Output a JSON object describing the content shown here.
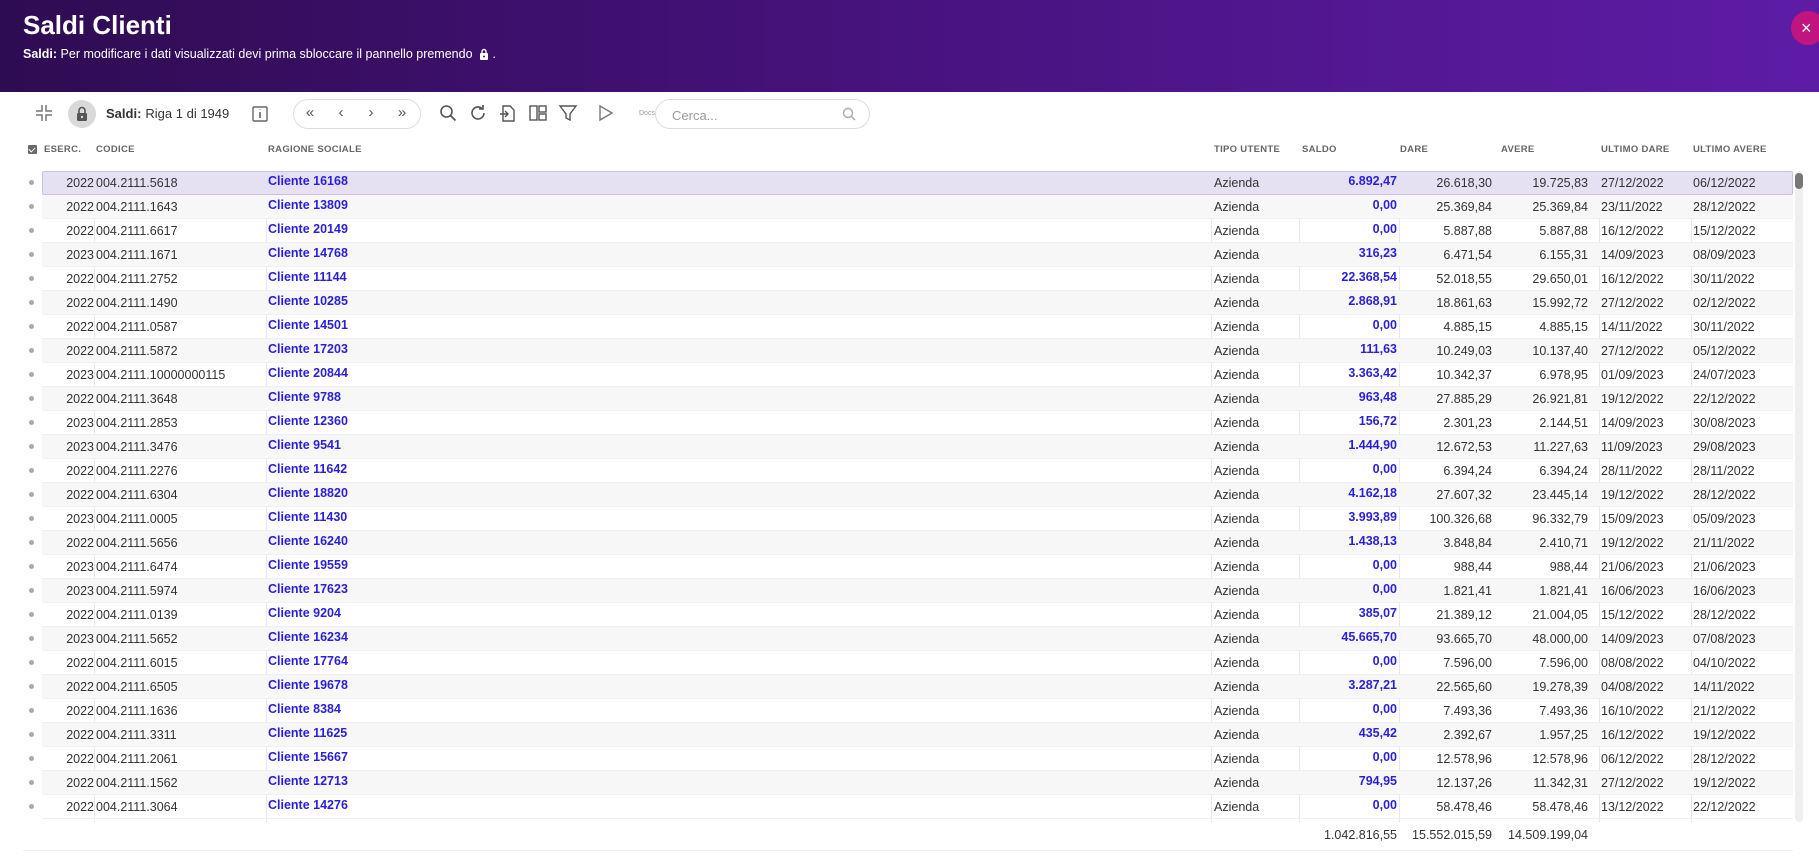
{
  "header": {
    "title": "Saldi Clienti",
    "subtitle_bold": "Saldi:",
    "subtitle_text": "Per modificare i dati visualizzati devi prima sbloccare il pannello premendo",
    "subtitle_end": ".",
    "close_label": "×"
  },
  "toolbar": {
    "section_label": "Saldi:",
    "row_info": "Riga 1 di 1949",
    "nav_first": "«",
    "nav_prev": "‹",
    "nav_next": "›",
    "nav_last": "»",
    "docs_label": "Docs",
    "search_placeholder": "Cerca...",
    "icons": [
      "collapse-icon",
      "lock-icon",
      "info-icon",
      "search-icon",
      "refresh-icon",
      "export-icon",
      "layout-icon",
      "filter-icon",
      "docs-icon"
    ]
  },
  "columns": {
    "eserc": "ESERC.",
    "codice": "CODICE",
    "ragione": "RAGIONE SOCIALE",
    "tipo": "TIPO UTENTE",
    "saldo": "SALDO",
    "dare": "DARE",
    "avere": "AVERE",
    "ultimo_dare": "ULTIMO DARE",
    "ultimo_avere": "ULTIMO AVERE"
  },
  "rows": [
    {
      "eserc": "2022",
      "codice": "004.2111.5618",
      "ragione": "Cliente 16168",
      "tipo": "Azienda",
      "saldo": "6.892,47",
      "dare": "26.618,30",
      "avere": "19.725,83",
      "ultimo_dare": "27/12/2022",
      "ultimo_avere": "06/12/2022"
    },
    {
      "eserc": "2022",
      "codice": "004.2111.1643",
      "ragione": "Cliente 13809",
      "tipo": "Azienda",
      "saldo": "0,00",
      "dare": "25.369,84",
      "avere": "25.369,84",
      "ultimo_dare": "23/11/2022",
      "ultimo_avere": "28/12/2022"
    },
    {
      "eserc": "2022",
      "codice": "004.2111.6617",
      "ragione": "Cliente 20149",
      "tipo": "Azienda",
      "saldo": "0,00",
      "dare": "5.887,88",
      "avere": "5.887,88",
      "ultimo_dare": "16/12/2022",
      "ultimo_avere": "15/12/2022"
    },
    {
      "eserc": "2023",
      "codice": "004.2111.1671",
      "ragione": "Cliente 14768",
      "tipo": "Azienda",
      "saldo": "316,23",
      "dare": "6.471,54",
      "avere": "6.155,31",
      "ultimo_dare": "14/09/2023",
      "ultimo_avere": "08/09/2023"
    },
    {
      "eserc": "2022",
      "codice": "004.2111.2752",
      "ragione": "Cliente 11144",
      "tipo": "Azienda",
      "saldo": "22.368,54",
      "dare": "52.018,55",
      "avere": "29.650,01",
      "ultimo_dare": "16/12/2022",
      "ultimo_avere": "30/11/2022"
    },
    {
      "eserc": "2022",
      "codice": "004.2111.1490",
      "ragione": "Cliente 10285",
      "tipo": "Azienda",
      "saldo": "2.868,91",
      "dare": "18.861,63",
      "avere": "15.992,72",
      "ultimo_dare": "27/12/2022",
      "ultimo_avere": "02/12/2022"
    },
    {
      "eserc": "2022",
      "codice": "004.2111.0587",
      "ragione": "Cliente 14501",
      "tipo": "Azienda",
      "saldo": "0,00",
      "dare": "4.885,15",
      "avere": "4.885,15",
      "ultimo_dare": "14/11/2022",
      "ultimo_avere": "30/11/2022"
    },
    {
      "eserc": "2022",
      "codice": "004.2111.5872",
      "ragione": "Cliente 17203",
      "tipo": "Azienda",
      "saldo": "111,63",
      "dare": "10.249,03",
      "avere": "10.137,40",
      "ultimo_dare": "27/12/2022",
      "ultimo_avere": "05/12/2022"
    },
    {
      "eserc": "2023",
      "codice": "004.2111.10000000115",
      "ragione": "Cliente 20844",
      "tipo": "Azienda",
      "saldo": "3.363,42",
      "dare": "10.342,37",
      "avere": "6.978,95",
      "ultimo_dare": "01/09/2023",
      "ultimo_avere": "24/07/2023"
    },
    {
      "eserc": "2022",
      "codice": "004.2111.3648",
      "ragione": "Cliente 9788",
      "tipo": "Azienda",
      "saldo": "963,48",
      "dare": "27.885,29",
      "avere": "26.921,81",
      "ultimo_dare": "19/12/2022",
      "ultimo_avere": "22/12/2022"
    },
    {
      "eserc": "2023",
      "codice": "004.2111.2853",
      "ragione": "Cliente 12360",
      "tipo": "Azienda",
      "saldo": "156,72",
      "dare": "2.301,23",
      "avere": "2.144,51",
      "ultimo_dare": "14/09/2023",
      "ultimo_avere": "30/08/2023"
    },
    {
      "eserc": "2023",
      "codice": "004.2111.3476",
      "ragione": "Cliente 9541",
      "tipo": "Azienda",
      "saldo": "1.444,90",
      "dare": "12.672,53",
      "avere": "11.227,63",
      "ultimo_dare": "11/09/2023",
      "ultimo_avere": "29/08/2023"
    },
    {
      "eserc": "2022",
      "codice": "004.2111.2276",
      "ragione": "Cliente 11642",
      "tipo": "Azienda",
      "saldo": "0,00",
      "dare": "6.394,24",
      "avere": "6.394,24",
      "ultimo_dare": "28/11/2022",
      "ultimo_avere": "28/11/2022"
    },
    {
      "eserc": "2022",
      "codice": "004.2111.6304",
      "ragione": "Cliente 18820",
      "tipo": "Azienda",
      "saldo": "4.162,18",
      "dare": "27.607,32",
      "avere": "23.445,14",
      "ultimo_dare": "19/12/2022",
      "ultimo_avere": "28/12/2022"
    },
    {
      "eserc": "2023",
      "codice": "004.2111.0005",
      "ragione": "Cliente 11430",
      "tipo": "Azienda",
      "saldo": "3.993,89",
      "dare": "100.326,68",
      "avere": "96.332,79",
      "ultimo_dare": "15/09/2023",
      "ultimo_avere": "05/09/2023"
    },
    {
      "eserc": "2022",
      "codice": "004.2111.5656",
      "ragione": "Cliente 16240",
      "tipo": "Azienda",
      "saldo": "1.438,13",
      "dare": "3.848,84",
      "avere": "2.410,71",
      "ultimo_dare": "19/12/2022",
      "ultimo_avere": "21/11/2022"
    },
    {
      "eserc": "2023",
      "codice": "004.2111.6474",
      "ragione": "Cliente 19559",
      "tipo": "Azienda",
      "saldo": "0,00",
      "dare": "988,44",
      "avere": "988,44",
      "ultimo_dare": "21/06/2023",
      "ultimo_avere": "21/06/2023"
    },
    {
      "eserc": "2023",
      "codice": "004.2111.5974",
      "ragione": "Cliente 17623",
      "tipo": "Azienda",
      "saldo": "0,00",
      "dare": "1.821,41",
      "avere": "1.821,41",
      "ultimo_dare": "16/06/2023",
      "ultimo_avere": "16/06/2023"
    },
    {
      "eserc": "2022",
      "codice": "004.2111.0139",
      "ragione": "Cliente 9204",
      "tipo": "Azienda",
      "saldo": "385,07",
      "dare": "21.389,12",
      "avere": "21.004,05",
      "ultimo_dare": "15/12/2022",
      "ultimo_avere": "28/12/2022"
    },
    {
      "eserc": "2023",
      "codice": "004.2111.5652",
      "ragione": "Cliente 16234",
      "tipo": "Azienda",
      "saldo": "45.665,70",
      "dare": "93.665,70",
      "avere": "48.000,00",
      "ultimo_dare": "14/09/2023",
      "ultimo_avere": "07/08/2023"
    },
    {
      "eserc": "2022",
      "codice": "004.2111.6015",
      "ragione": "Cliente 17764",
      "tipo": "Azienda",
      "saldo": "0,00",
      "dare": "7.596,00",
      "avere": "7.596,00",
      "ultimo_dare": "08/08/2022",
      "ultimo_avere": "04/10/2022"
    },
    {
      "eserc": "2022",
      "codice": "004.2111.6505",
      "ragione": "Cliente 19678",
      "tipo": "Azienda",
      "saldo": "3.287,21",
      "dare": "22.565,60",
      "avere": "19.278,39",
      "ultimo_dare": "04/08/2022",
      "ultimo_avere": "14/11/2022"
    },
    {
      "eserc": "2022",
      "codice": "004.2111.1636",
      "ragione": "Cliente 8384",
      "tipo": "Azienda",
      "saldo": "0,00",
      "dare": "7.493,36",
      "avere": "7.493,36",
      "ultimo_dare": "16/10/2022",
      "ultimo_avere": "21/12/2022"
    },
    {
      "eserc": "2022",
      "codice": "004.2111.3311",
      "ragione": "Cliente 11625",
      "tipo": "Azienda",
      "saldo": "435,42",
      "dare": "2.392,67",
      "avere": "1.957,25",
      "ultimo_dare": "16/12/2022",
      "ultimo_avere": "19/12/2022"
    },
    {
      "eserc": "2022",
      "codice": "004.2111.2061",
      "ragione": "Cliente 15667",
      "tipo": "Azienda",
      "saldo": "0,00",
      "dare": "12.578,96",
      "avere": "12.578,96",
      "ultimo_dare": "06/12/2022",
      "ultimo_avere": "28/12/2022"
    },
    {
      "eserc": "2022",
      "codice": "004.2111.1562",
      "ragione": "Cliente 12713",
      "tipo": "Azienda",
      "saldo": "794,95",
      "dare": "12.137,26",
      "avere": "11.342,31",
      "ultimo_dare": "27/12/2022",
      "ultimo_avere": "19/12/2022"
    },
    {
      "eserc": "2022",
      "codice": "004.2111.3064",
      "ragione": "Cliente 14276",
      "tipo": "Azienda",
      "saldo": "0,00",
      "dare": "58.478,46",
      "avere": "58.478,46",
      "ultimo_dare": "13/12/2022",
      "ultimo_avere": "22/12/2022"
    }
  ],
  "totals": {
    "saldo": "1.042.816,55",
    "dare": "15.552.015,59",
    "avere": "14.509.199,04"
  },
  "colors": {
    "header_start": "#2e0c52",
    "header_end": "#5e1ca6",
    "link": "#2a1fd6",
    "selected_row": "#e6e0f3",
    "close_button": "#c0157e"
  }
}
